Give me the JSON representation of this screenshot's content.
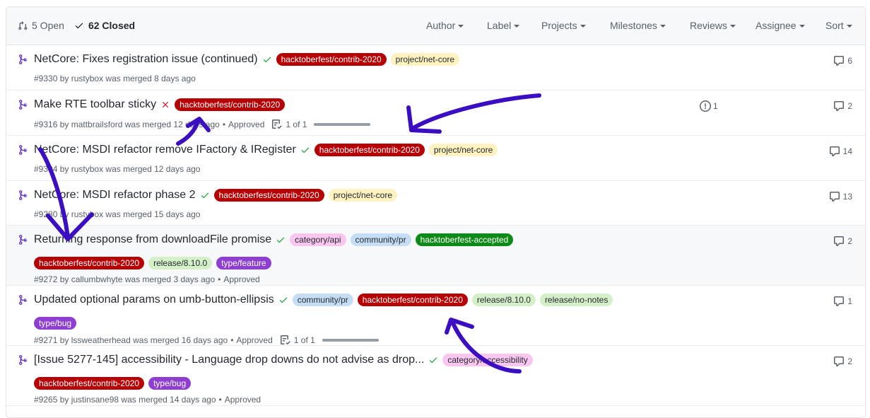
{
  "header": {
    "open_count": "5 Open",
    "closed_count": "62 Closed",
    "filters": {
      "author": "Author",
      "label": "Label",
      "projects": "Projects",
      "milestones": "Milestones",
      "reviews": "Reviews",
      "assignee": "Assignee",
      "sort": "Sort"
    }
  },
  "colors": {
    "merged_icon": "#6f42c1",
    "check": "#28a745",
    "fail": "#cb2431",
    "annotation_arrow": "#3b0fc1"
  },
  "labels": {
    "hacktoberfest_contrib": "hacktoberfest/contrib-2020",
    "project_netcore": "project/net-core",
    "category_api": "category/api",
    "community_pr": "community/pr",
    "hacktoberfest_accepted": "hacktoberfest-accepted",
    "release_8100": "release/8.10.0",
    "type_feature": "type/feature",
    "type_bug": "type/bug",
    "release_nonotes": "release/no-notes",
    "category_accessibility": "category/accessibility"
  },
  "rows": [
    {
      "title": "NetCore: Fixes registration issue (continued)",
      "meta": "#9330 by rustybox was merged 8 days ago",
      "comments": "6"
    },
    {
      "title": "Make RTE toolbar sticky",
      "meta": "#9316 by mattbrailsford was merged 12 days ago",
      "approved": "Approved",
      "tasks": "1 of 1",
      "linked_issues": "1",
      "comments": "2"
    },
    {
      "title": "NetCore: MSDI refactor remove IFactory & IRegister",
      "meta": "#9304 by rustybox was merged 12 days ago",
      "comments": "14"
    },
    {
      "title": "NetCore: MSDI refactor phase 2",
      "meta": "#9280 by rustybox was merged 15 days ago",
      "comments": "13"
    },
    {
      "title": "Returning response from downloadFile promise",
      "meta": "#9272 by callumbwhyte was merged 3 days ago",
      "approved": "Approved",
      "comments": "2"
    },
    {
      "title": "Updated optional params on umb-button-ellipsis",
      "meta": "#9271 by lssweatherhead was merged 16 days ago",
      "approved": "Approved",
      "tasks": "1 of 1",
      "comments": "1"
    },
    {
      "title": "[Issue 5277-145] accessibility - Language drop downs do not advise as drop...",
      "meta": "#9265 by justinsane98 was merged 14 days ago",
      "approved": "Approved",
      "comments": "2"
    }
  ]
}
